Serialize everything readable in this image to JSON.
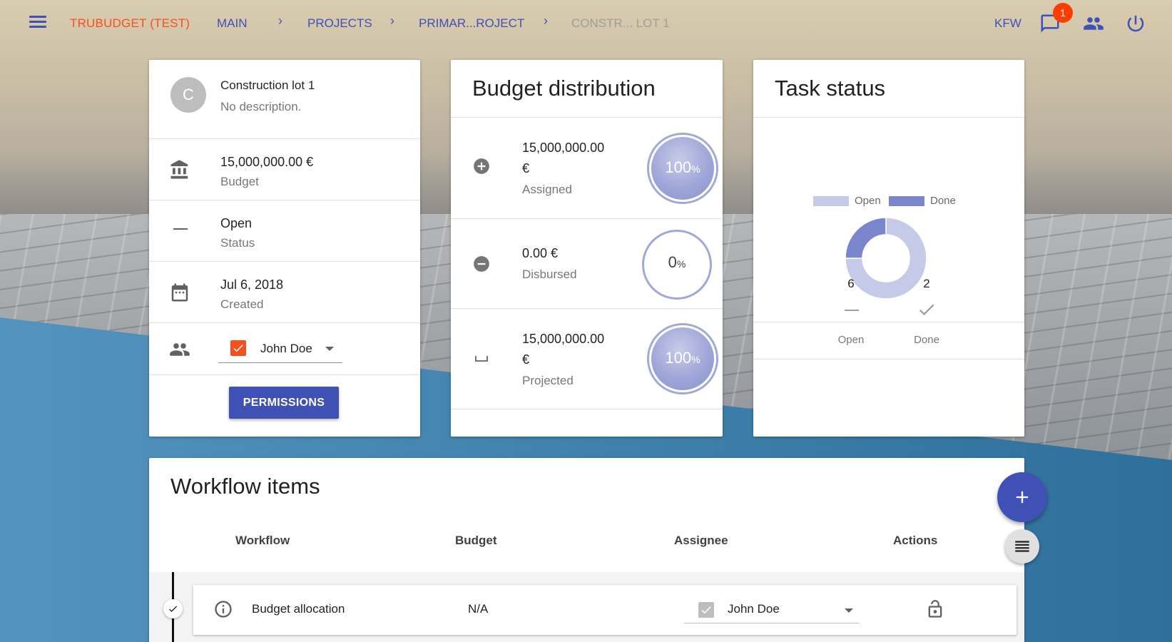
{
  "app": {
    "brand": "TRUBUDGET (TEST)",
    "breadcrumbs": [
      "MAIN",
      "PROJECTS",
      "PRIMAR...ROJECT",
      "CONSTR... LOT 1"
    ],
    "organization": "KFW",
    "notification_count": "1"
  },
  "details": {
    "avatar_letter": "C",
    "name": "Construction lot 1",
    "description": "No description.",
    "budget_value": "15,000,000.00 €",
    "budget_label": "Budget",
    "status_value": "Open",
    "status_label": "Status",
    "created_value": "Jul 6, 2018",
    "created_label": "Created",
    "assignee": "John Doe",
    "permissions_label": "PERMISSIONS"
  },
  "budget": {
    "title": "Budget distribution",
    "assigned_amount_line1": "15,000,000.00",
    "assigned_amount_line2": "€",
    "assigned_label": "Assigned",
    "assigned_pct": "100",
    "disbursed_amount": "0.00 €",
    "disbursed_label": "Disbursed",
    "disbursed_pct": "0",
    "projected_amount_line1": "15,000,000.00",
    "projected_amount_line2": "€",
    "projected_label": "Projected",
    "projected_pct": "100",
    "pct_sign": "%"
  },
  "tasks": {
    "title": "Task status",
    "legend_open": "Open",
    "legend_done": "Done",
    "open_count": "6",
    "done_count": "2",
    "open_label": "Open",
    "done_label": "Done"
  },
  "chart_data": {
    "type": "pie",
    "categories": [
      "Open",
      "Done"
    ],
    "values": [
      6,
      2
    ],
    "colors": [
      "#c5cae9",
      "#7986cb"
    ]
  },
  "workflow": {
    "title": "Workflow items",
    "columns": [
      "Workflow",
      "Budget",
      "Assignee",
      "Actions"
    ],
    "items": [
      {
        "name": "Budget allocation",
        "budget": "N/A",
        "assignee": "John Doe"
      }
    ]
  },
  "colors": {
    "primary": "#3f51b5",
    "accent": "#f4511e",
    "badge": "#ff3d00"
  }
}
